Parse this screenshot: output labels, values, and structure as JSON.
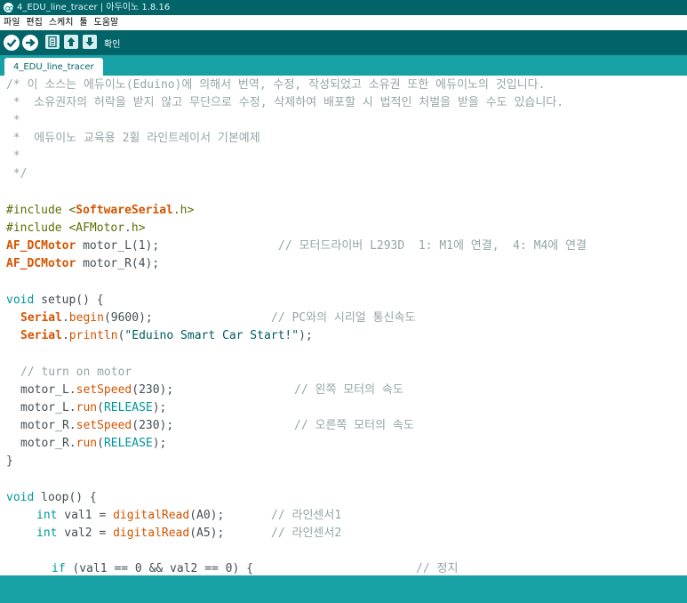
{
  "window": {
    "title": "4_EDU_line_tracer | 아두이노 1.8.16"
  },
  "menu": [
    "파일",
    "편집",
    "스케치",
    "툴",
    "도움말"
  ],
  "toolbar": {
    "status_label": "확인"
  },
  "tab": {
    "label": "4_EDU_line_tracer"
  },
  "code": {
    "l01": "/* 이 소스는 에듀이노(Eduino)에 의해서 번역, 수정, 작성되었고 소유권 또한 에듀이노의 것입니다.",
    "l02": " *  소유권자의 허락을 받지 않고 무단으로 수정, 삭제하여 배포할 시 법적인 처벌을 받을 수도 있습니다.",
    "l03": " *",
    "l04": " *  에듀이노 교육용 2휠 라인트레이서 기본예제",
    "l05": " *",
    "l06": " */",
    "l08a": "#include <",
    "l08b": "SoftwareSerial",
    "l08c": ".h>",
    "l09": "#include <AFMotor.h>",
    "l10a": "AF_DCMotor",
    "l10b": " motor_L(1);",
    "l10c": "// 모터드라이버 L293D  1: M1에 연결,  4: M4에 연결",
    "l11a": "AF_DCMotor",
    "l11b": " motor_R(4);",
    "l13a": "void",
    "l13b": " setup() {",
    "l14a": "Serial",
    "l14b": ".",
    "l14c": "begin",
    "l14d": "(9600);",
    "l14e": "// PC와의 시리얼 통신속도",
    "l15a": "Serial",
    "l15b": ".",
    "l15c": "println",
    "l15d": "(",
    "l15e": "\"Eduino Smart Car Start!\"",
    "l15f": ");",
    "l17": "// turn on motor",
    "l18a": "motor_L.",
    "l18b": "setSpeed",
    "l18c": "(230);",
    "l18d": "// 왼쪽 모터의 속도",
    "l19a": "motor_L.",
    "l19b": "run",
    "l19c": "(",
    "l19d": "RELEASE",
    "l19e": ");",
    "l20a": "motor_R.",
    "l20b": "setSpeed",
    "l20c": "(230);",
    "l20d": "// 오른쪽 모터의 속도",
    "l21a": "motor_R.",
    "l21b": "run",
    "l21c": "(",
    "l21d": "RELEASE",
    "l21e": ");",
    "l22": "}",
    "l24a": "void",
    "l24b": " loop() {",
    "l25a": "int",
    "l25b": " val1 = ",
    "l25c": "digitalRead",
    "l25d": "(A0);",
    "l25e": "// 라인센서1",
    "l26a": "int",
    "l26b": " val2 = ",
    "l26c": "digitalRead",
    "l26d": "(A5);",
    "l26e": "// 라인센서2",
    "l28a": "if",
    "l28b": " (val1 == 0 && val2 == 0) {",
    "l28c": "// 정지"
  },
  "colors": {
    "teal_dark": "#006468",
    "teal": "#17a1a5",
    "comment": "#95a5a6",
    "keyword": "#00979c",
    "type": "#d35400"
  }
}
